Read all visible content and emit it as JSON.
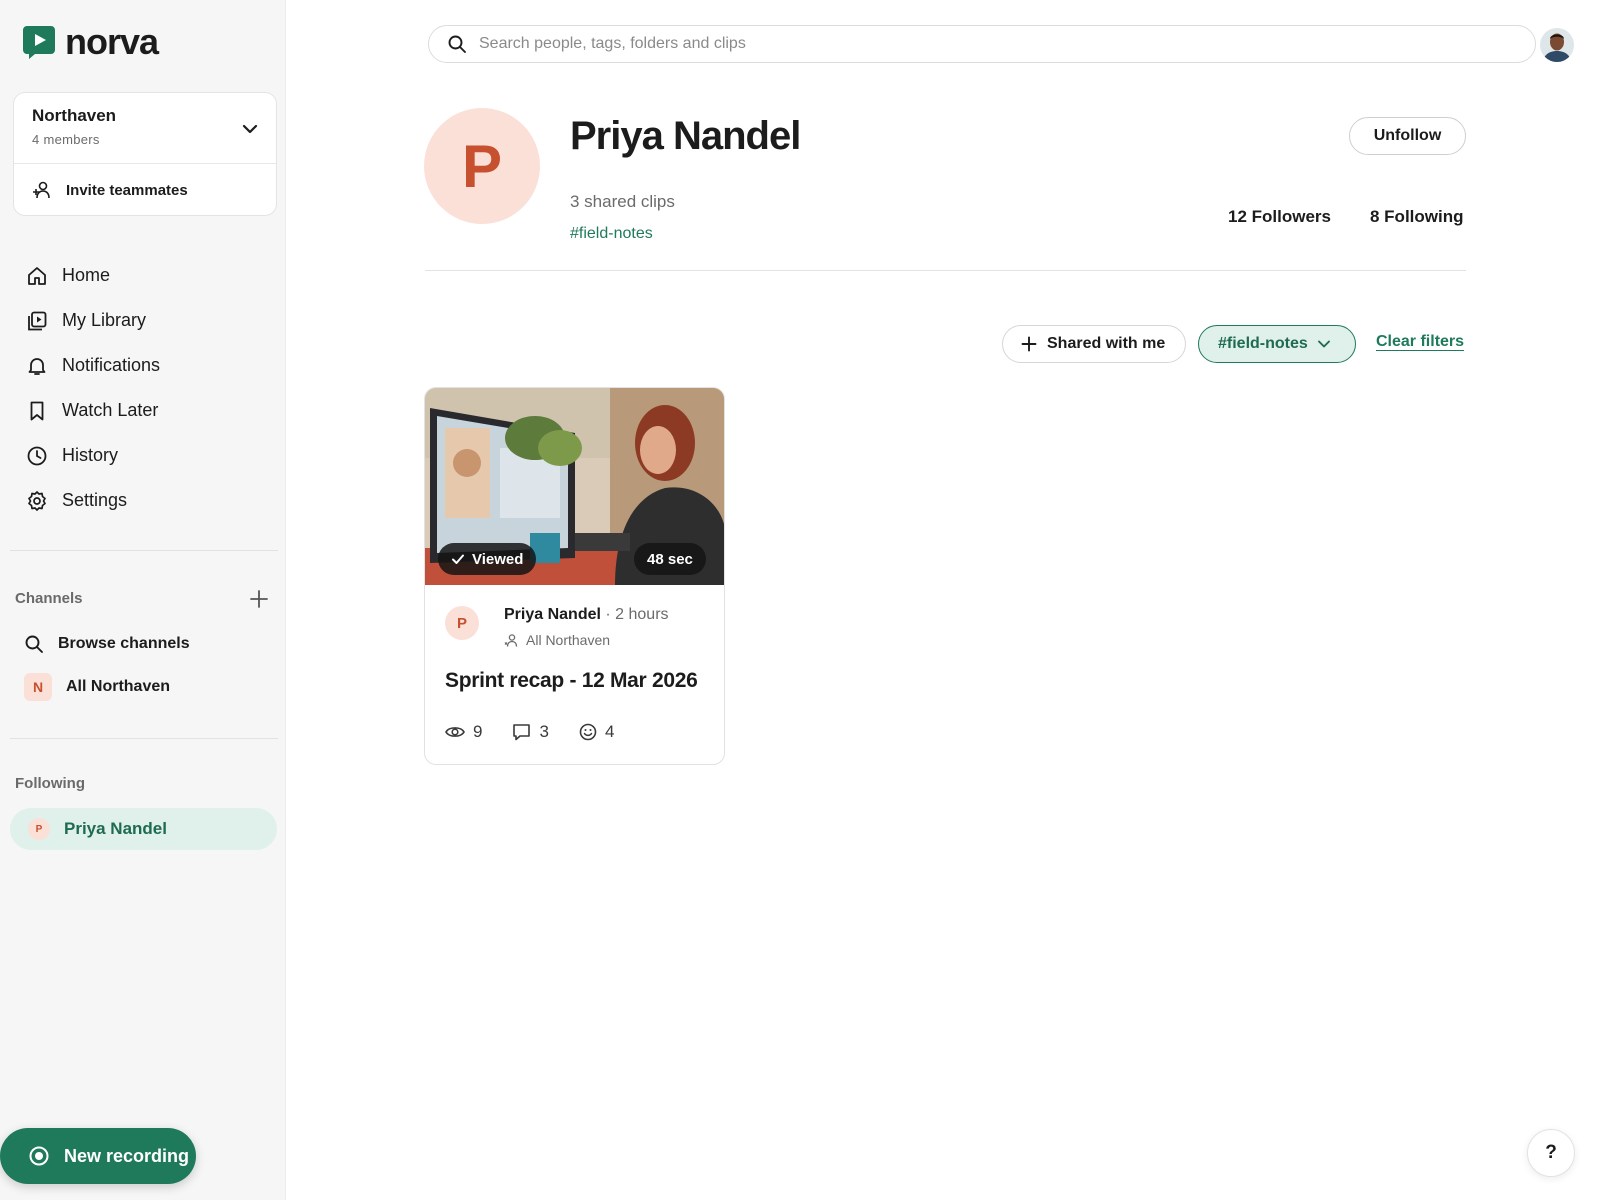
{
  "app": {
    "brand": "norva",
    "accent": "#1f7a5c"
  },
  "workspace": {
    "name": "Northaven",
    "members": "4 members",
    "invite_label": "Invite teammates"
  },
  "nav": [
    {
      "label": "Home",
      "icon": "home-icon"
    },
    {
      "label": "My Library",
      "icon": "library-icon"
    },
    {
      "label": "Notifications",
      "icon": "bell-icon"
    },
    {
      "label": "Watch Later",
      "icon": "bookmark-icon"
    },
    {
      "label": "History",
      "icon": "clock-icon"
    },
    {
      "label": "Settings",
      "icon": "gear-icon"
    }
  ],
  "channels": {
    "heading": "Channels",
    "browse_label": "Browse channels",
    "items": [
      {
        "label": "All Northaven",
        "badge": "N"
      }
    ]
  },
  "following": {
    "heading": "Following",
    "items": [
      {
        "label": "Priya Nandel",
        "initial": "P"
      }
    ]
  },
  "new_recording_label": "New recording",
  "search": {
    "placeholder": "Search people, tags, folders and clips"
  },
  "profile": {
    "initial": "P",
    "name": "Priya Nandel",
    "shared_clips": "3 shared clips",
    "tag": "#field-notes",
    "unfollow_label": "Unfollow",
    "followers": "12 Followers",
    "following": "8 Following"
  },
  "filters": {
    "shared_label": "Shared with me",
    "tag_label": "#field-notes",
    "clear_label": "Clear filters"
  },
  "card": {
    "viewed_label": "Viewed",
    "duration": "48 sec",
    "author_initial": "P",
    "author": "Priya Nandel",
    "time": "· 2 hours",
    "channel": "All Northaven",
    "title": "Sprint recap - 12 Mar 2026",
    "views": "9",
    "comments": "3",
    "reactions": "4"
  },
  "help_label": "?"
}
